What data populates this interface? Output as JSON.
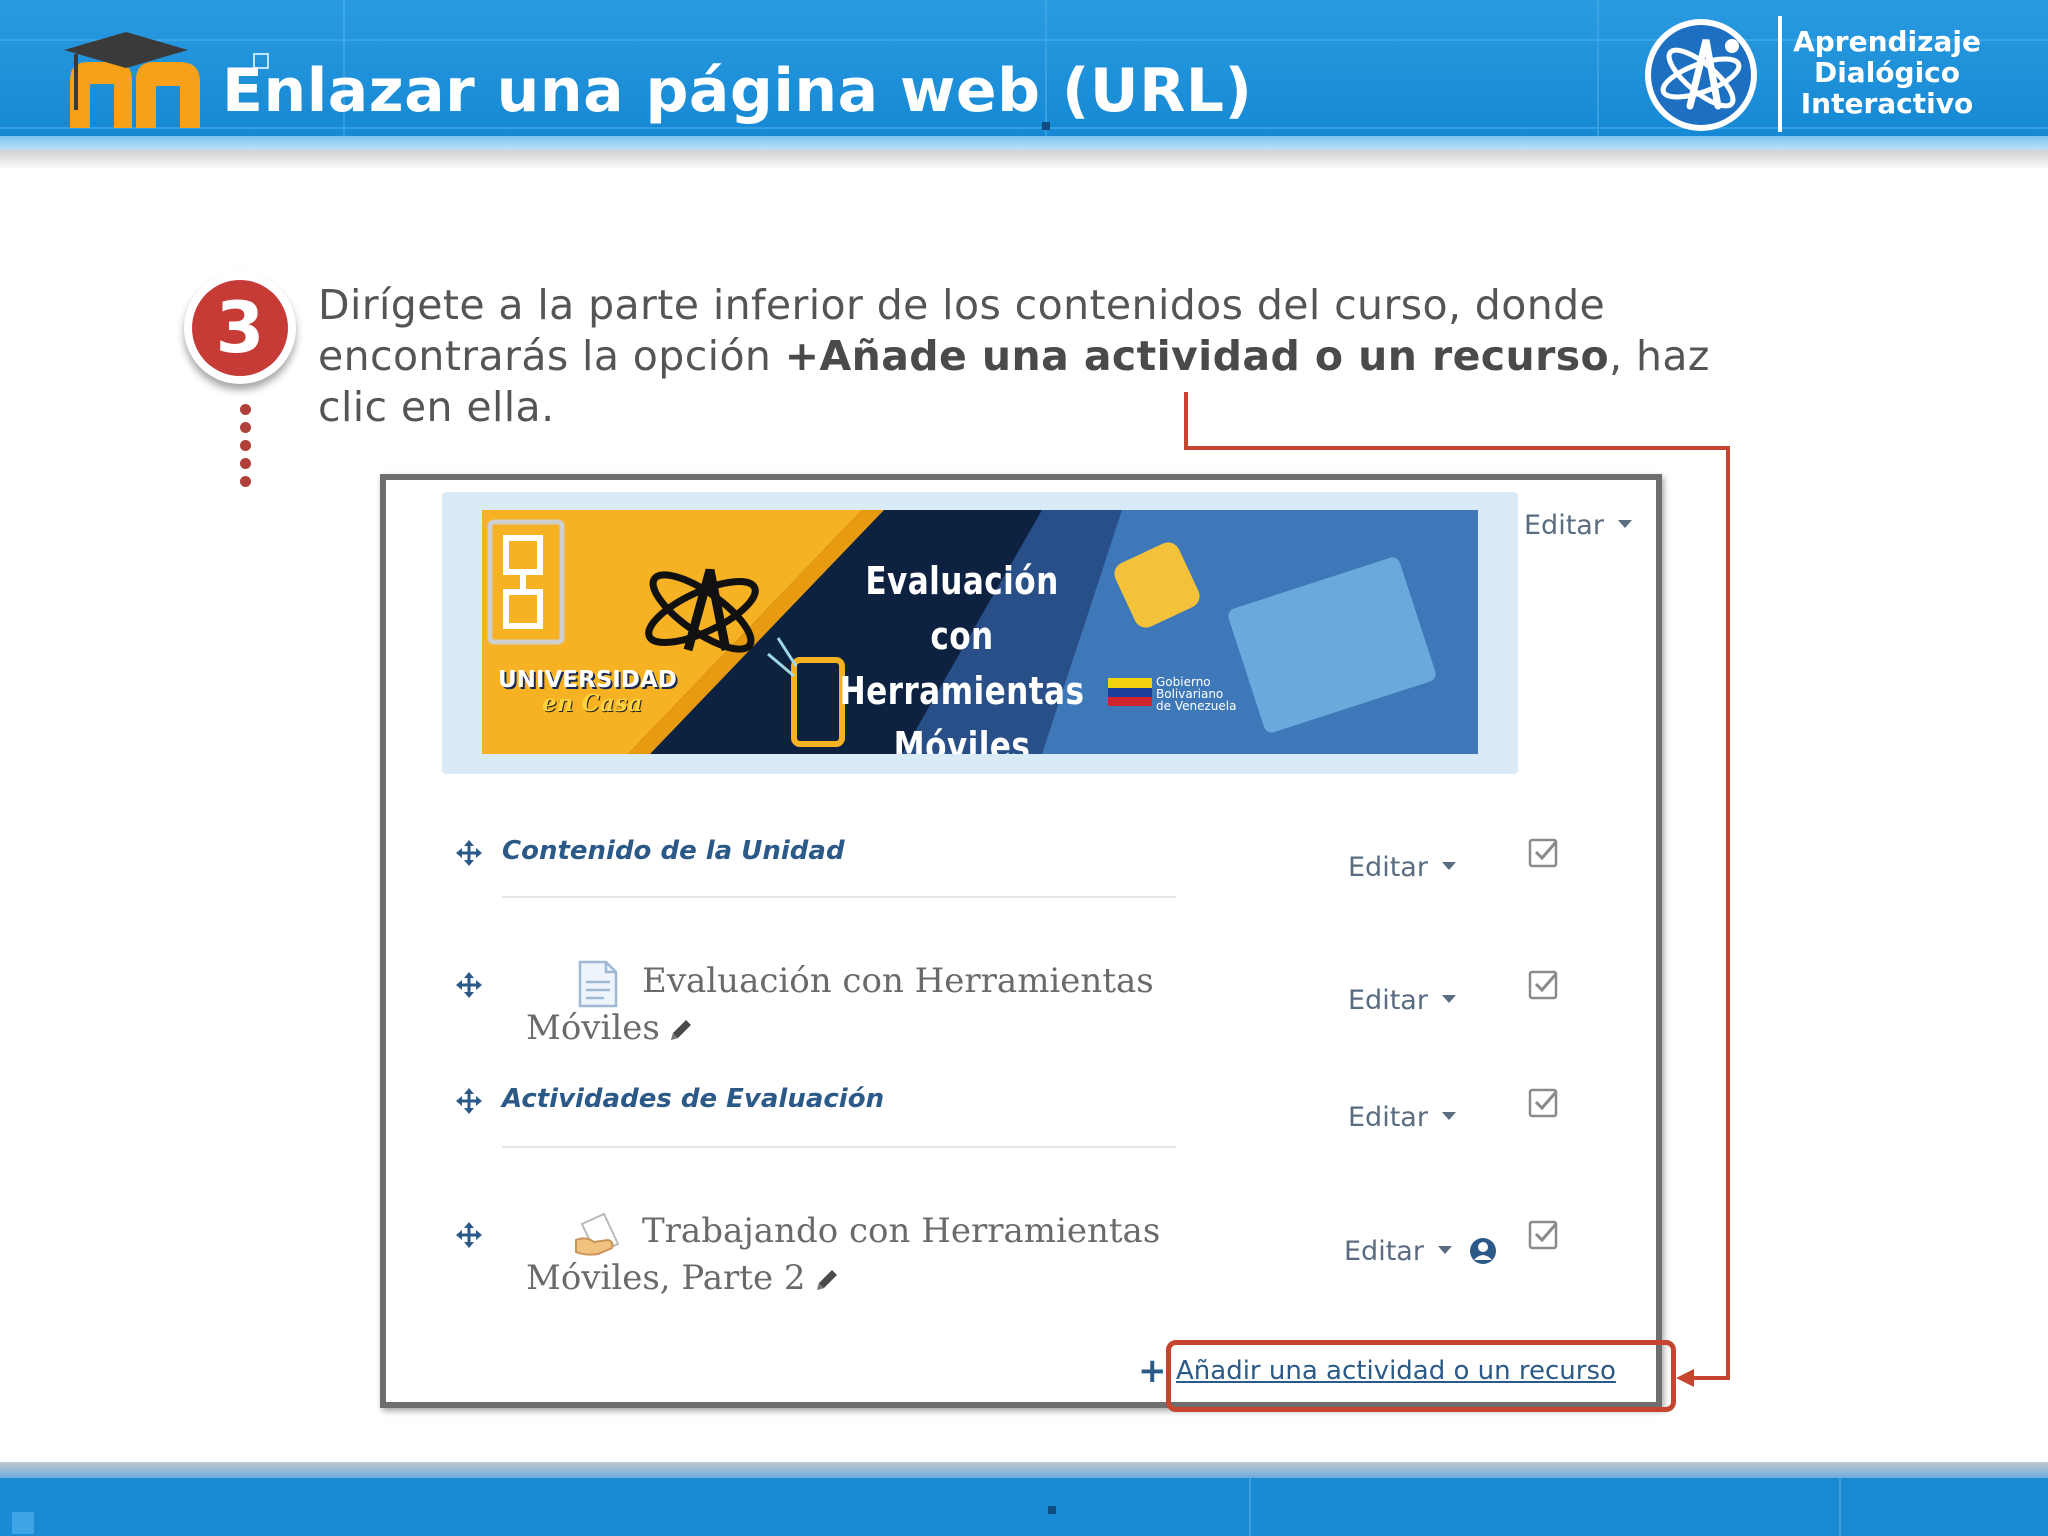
{
  "header": {
    "title": "Enlazar una página web (URL)",
    "brand_lines": [
      "Aprendizaje",
      "Dialógico",
      "Interactivo"
    ],
    "colors": {
      "band": "#1487d3",
      "logo_m": "#f7a11a",
      "accent_red": "#c73b37"
    },
    "icons": {
      "logo": "moodle-logo-icon",
      "emblem": "atom-emblem-icon"
    }
  },
  "step": {
    "number": "3",
    "text_before": "Dirígete a la parte inferior de los contenidos del curso, donde encontrarás la opción ",
    "text_bold": "+Añade una actividad o un recurso",
    "text_after": ", haz clic en ella."
  },
  "course": {
    "banner": {
      "title_lines": [
        "Evaluación con",
        "Herramientas",
        "Móviles"
      ],
      "univ_lines": [
        "UNIVERSIDAD",
        "en Casa"
      ],
      "gov_lines": [
        "Gobierno",
        "Bolivariano",
        "de Venezuela"
      ]
    },
    "top_edit_label": "Editar",
    "sections": [
      {
        "title": "Contenido de la Unidad",
        "edit_label": "Editar"
      },
      {
        "title": "Actividades de Evaluación",
        "edit_label": "Editar"
      }
    ],
    "activities": [
      {
        "line1": "Evaluación con Herramientas",
        "line2": "Móviles",
        "edit_label": "Editar",
        "icon": "page-icon"
      },
      {
        "line1": "Trabajando con Herramientas",
        "line2": "Móviles, Parte 2",
        "edit_label": "Editar",
        "icon": "assignment-icon"
      }
    ],
    "add_label": "Añadir una actividad o un recurso"
  }
}
